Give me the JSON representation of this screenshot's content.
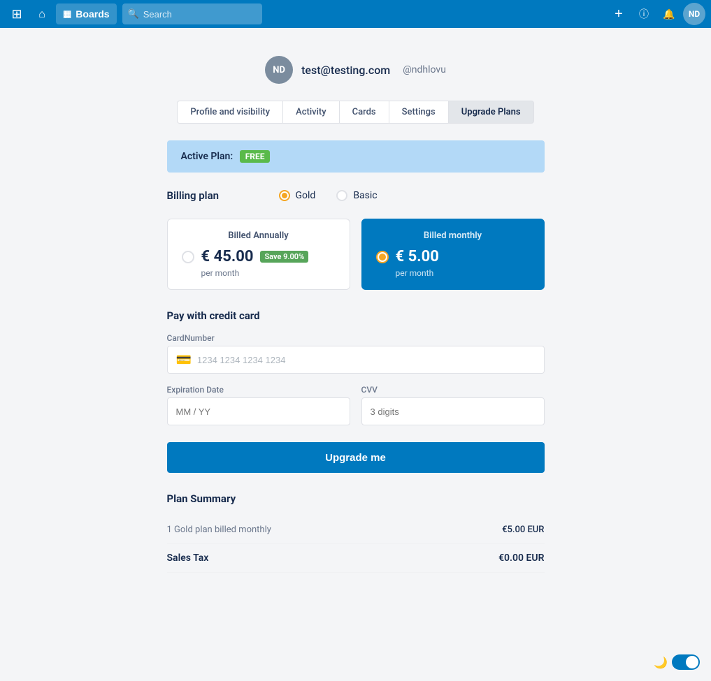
{
  "topnav": {
    "boards_label": "Boards",
    "search_placeholder": "Search",
    "add_label": "+",
    "avatar_initials": "ND"
  },
  "profile": {
    "avatar_initials": "ND",
    "email": "test@testing.com",
    "username": "@ndhlovu"
  },
  "tabs": [
    {
      "id": "profile",
      "label": "Profile and visibility",
      "active": false
    },
    {
      "id": "activity",
      "label": "Activity",
      "active": false
    },
    {
      "id": "cards",
      "label": "Cards",
      "active": false
    },
    {
      "id": "settings",
      "label": "Settings",
      "active": false
    },
    {
      "id": "upgrade",
      "label": "Upgrade Plans",
      "active": true
    }
  ],
  "active_plan": {
    "prefix": "Active Plan:",
    "badge": "FREE"
  },
  "billing_plan": {
    "label": "Billing plan",
    "options": [
      {
        "id": "gold",
        "label": "Gold",
        "selected": true
      },
      {
        "id": "basic",
        "label": "Basic",
        "selected": false
      }
    ]
  },
  "plan_cards": [
    {
      "id": "annually",
      "title": "Billed Annually",
      "price": "€ 45.00",
      "save_badge": "Save 9.00%",
      "per_month": "per month",
      "selected": false
    },
    {
      "id": "monthly",
      "title": "Billed monthly",
      "price": "€ 5.00",
      "save_badge": null,
      "per_month": "per month",
      "selected": true
    }
  ],
  "credit_card": {
    "section_title": "Pay with credit card",
    "card_number_label": "CardNumber",
    "card_number_placeholder": "1234 1234 1234 1234",
    "expiry_label": "Expiration Date",
    "expiry_placeholder": "MM / YY",
    "cvv_label": "CVV",
    "cvv_placeholder": "3 digits"
  },
  "upgrade_button_label": "Upgrade me",
  "plan_summary": {
    "title": "Plan Summary",
    "rows": [
      {
        "label": "1 Gold plan billed monthly",
        "value": "€5.00 EUR"
      },
      {
        "label": "Sales Tax",
        "value": "€0.00 EUR"
      }
    ]
  },
  "dark_mode": {
    "enabled": true
  }
}
